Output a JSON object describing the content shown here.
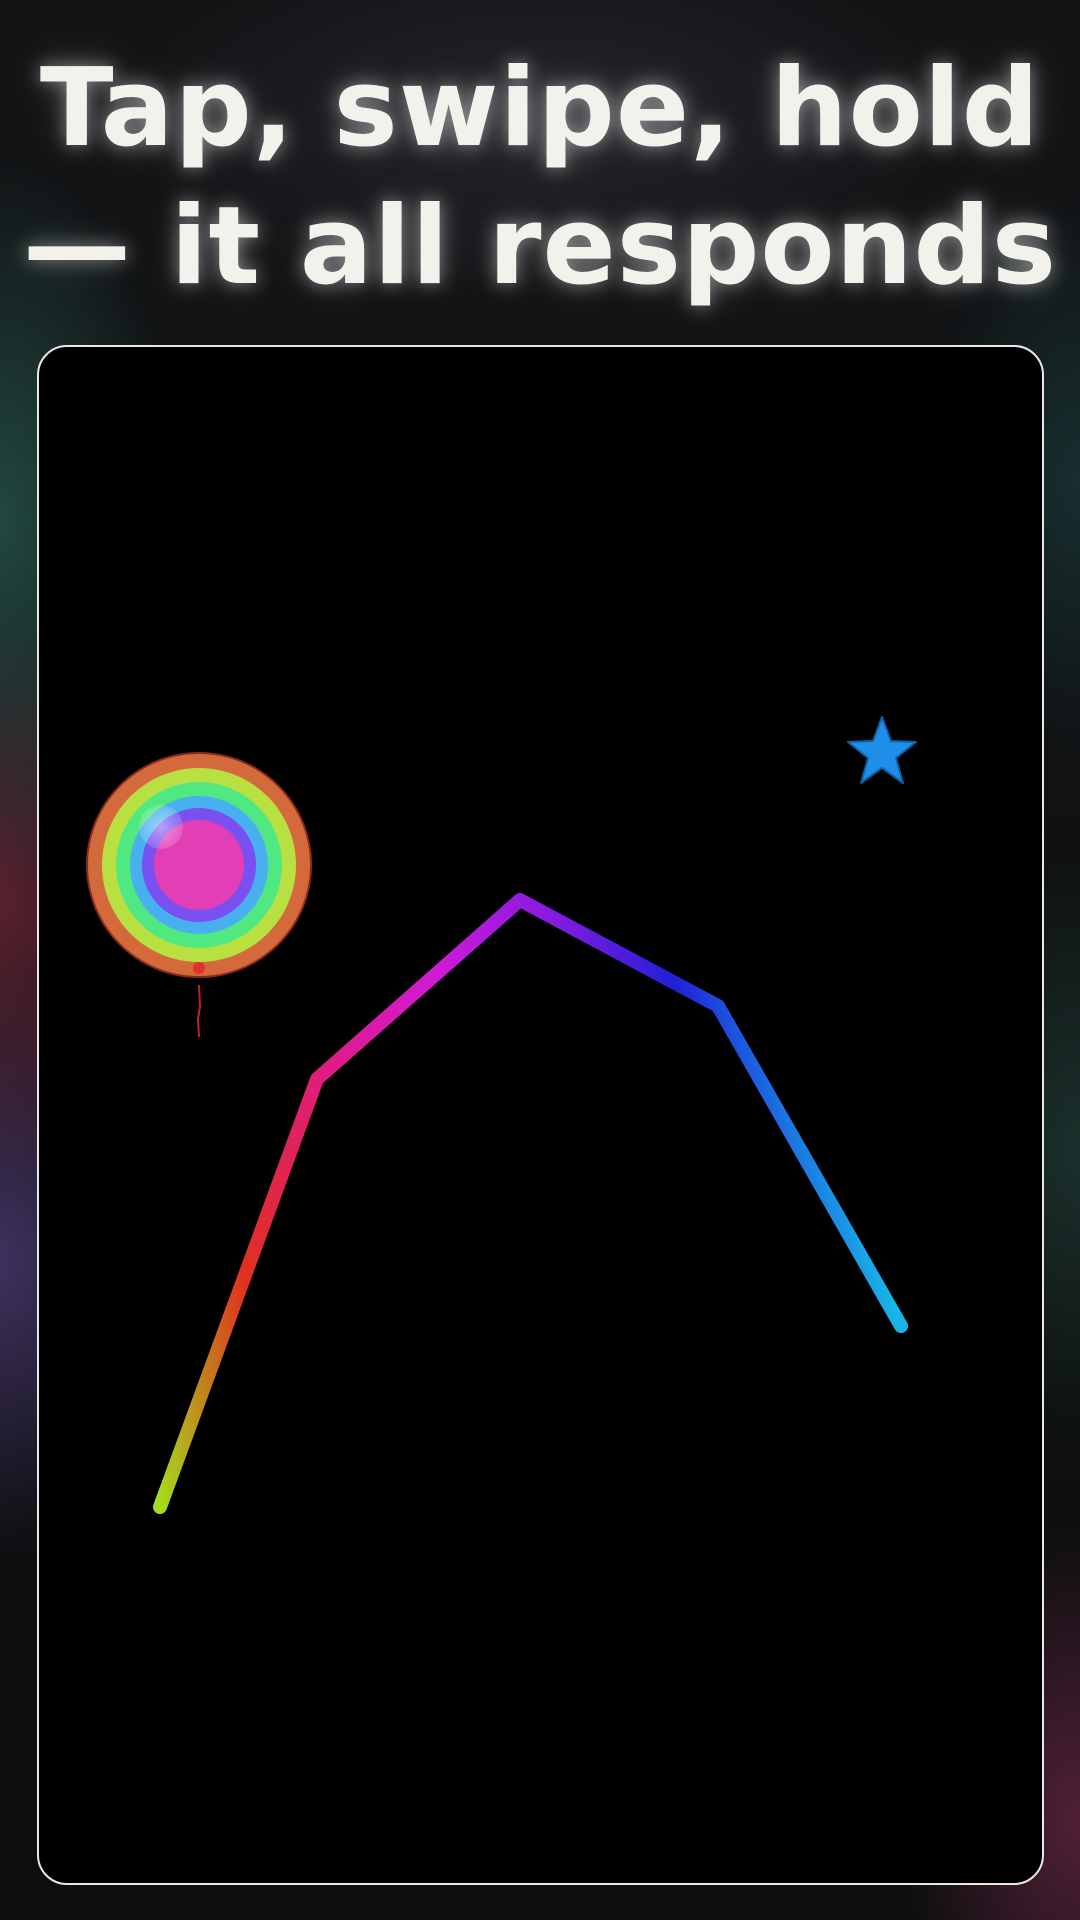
{
  "headline": {
    "line1": "Tap, swipe, hold",
    "line2": "— it all responds"
  },
  "canvas": {
    "background": "#000000",
    "border_color": "#e8e8e8",
    "stroke_gradient": [
      "#a4dd1e",
      "#e0301e",
      "#e01a8a",
      "#d01ad8",
      "#8a1ae0",
      "#2020d8",
      "#18b6e8"
    ],
    "ring_colors": [
      "#d46a3c",
      "#b8e040",
      "#50e880",
      "#48b0f0",
      "#7a50f0",
      "#e23eb6"
    ],
    "star_color": "#1e8ee8",
    "string_color": "#c82020"
  },
  "icons": {
    "ring": "balloon-rings-icon",
    "star": "star-icon"
  }
}
